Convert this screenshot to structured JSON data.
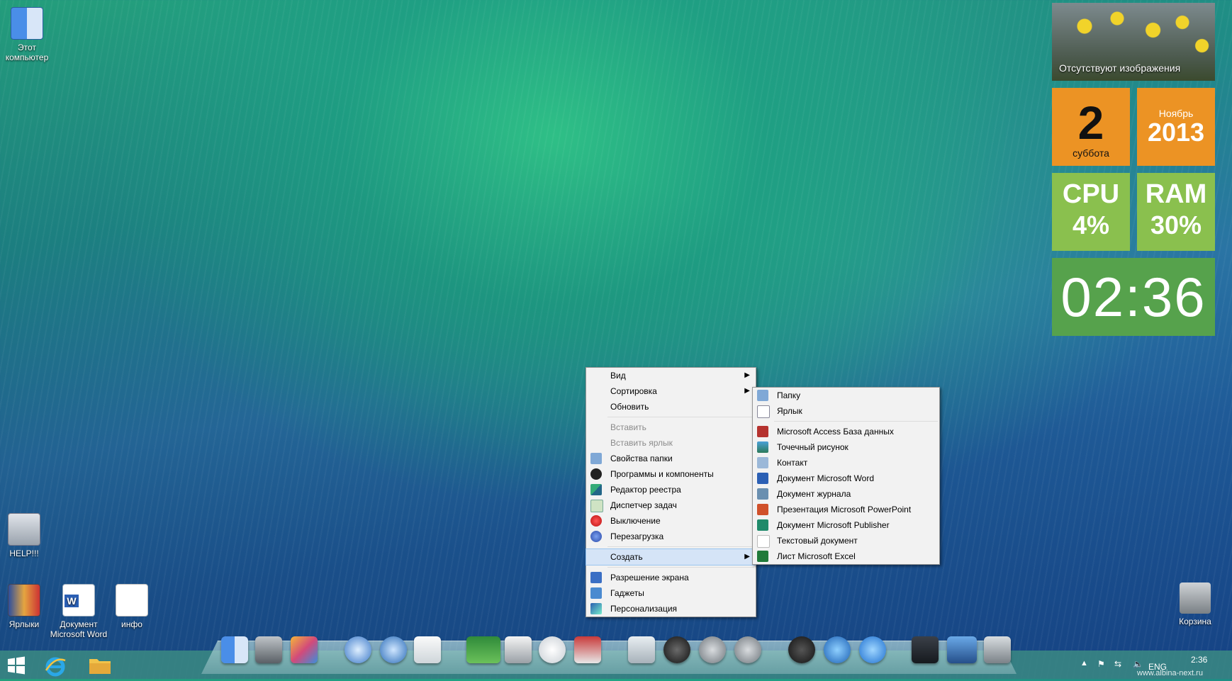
{
  "desktop": {
    "icons": {
      "computer": "Этот\nкомпьютер",
      "help": "HELP!!!",
      "labels": "Ярлыки",
      "word": "Документ Microsoft Word",
      "info": "инфо",
      "trash": "Корзина"
    }
  },
  "tiles": {
    "photo_caption": "Отсутствуют изображения",
    "day_number": "2",
    "day_name": "суббота",
    "month": "Ноябрь",
    "year": "2013",
    "cpu_label": "CPU",
    "cpu_value": "4%",
    "ram_label": "RAM",
    "ram_value": "30%",
    "clock": "02:36"
  },
  "context_menu": {
    "items": [
      {
        "label": "Вид",
        "submenu": true
      },
      {
        "label": "Сортировка",
        "submenu": true
      },
      {
        "label": "Обновить"
      },
      {
        "label": "Вставить",
        "disabled": true
      },
      {
        "label": "Вставить ярлык",
        "disabled": true
      },
      {
        "label": "Свойства папки",
        "icon": "folder-icon"
      },
      {
        "label": "Программы и компоненты",
        "icon": "programs-icon"
      },
      {
        "label": "Редактор реестра",
        "icon": "registry-icon"
      },
      {
        "label": "Диспетчер задач",
        "icon": "task-manager-icon"
      },
      {
        "label": "Выключение",
        "icon": "power-icon"
      },
      {
        "label": "Перезагрузка",
        "icon": "restart-icon"
      },
      {
        "label": "Создать",
        "submenu": true,
        "active": true
      },
      {
        "label": "Разрешение экрана",
        "icon": "display-icon"
      },
      {
        "label": "Гаджеты",
        "icon": "gadgets-icon"
      },
      {
        "label": "Персонализация",
        "icon": "personalize-icon"
      }
    ]
  },
  "create_submenu": {
    "items": [
      {
        "label": "Папку",
        "icon": "folder-icon"
      },
      {
        "label": "Ярлык",
        "icon": "shortcut-icon"
      },
      {
        "label": "Microsoft Access База данных",
        "icon": "access-icon"
      },
      {
        "label": "Точечный рисунок",
        "icon": "bitmap-icon"
      },
      {
        "label": "Контакт",
        "icon": "contact-icon"
      },
      {
        "label": "Документ Microsoft Word",
        "icon": "word-icon"
      },
      {
        "label": "Документ журнала",
        "icon": "journal-icon"
      },
      {
        "label": "Презентация Microsoft PowerPoint",
        "icon": "powerpoint-icon"
      },
      {
        "label": "Документ Microsoft Publisher",
        "icon": "publisher-icon"
      },
      {
        "label": "Текстовый документ",
        "icon": "text-doc-icon"
      },
      {
        "label": "Лист Microsoft Excel",
        "icon": "excel-icon"
      }
    ]
  },
  "taskbar": {
    "language": "ENG",
    "time": "2:36",
    "watermark": "www.albina-next.ru"
  },
  "colors": {
    "tile_orange": "#ec9324",
    "tile_green": "#8ac04e",
    "tile_clock": "#56a24c",
    "menu_highlight": "#d5e4f7"
  }
}
